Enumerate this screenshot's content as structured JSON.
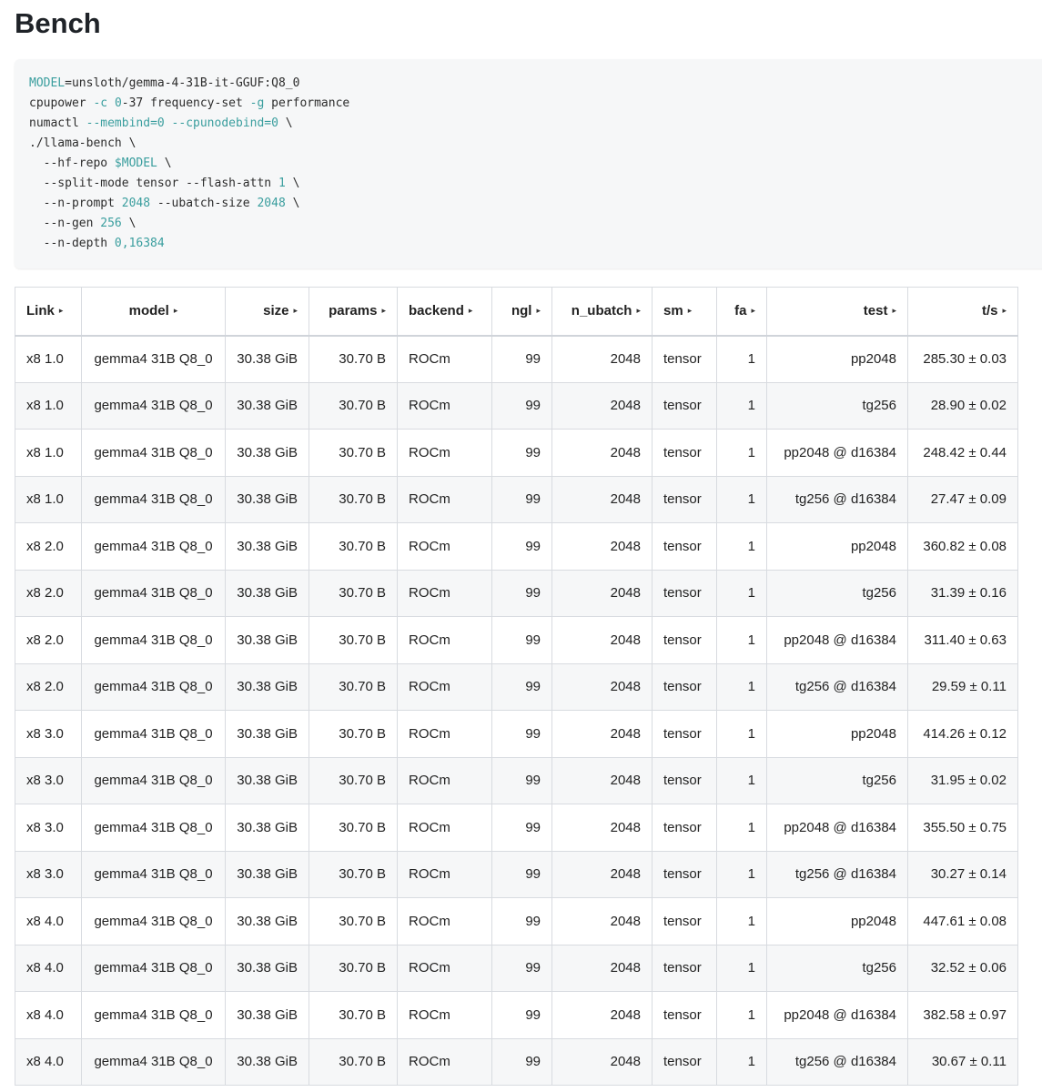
{
  "page": {
    "title": "Bench"
  },
  "code": {
    "lines": [
      [
        {
          "t": "MODEL",
          "hl": true
        },
        {
          "t": "=unsloth/gemma-4-31B-it-GGUF:Q8_0"
        }
      ],
      [
        {
          "t": "cpupower "
        },
        {
          "t": "-c",
          "hl": true
        },
        {
          "t": " "
        },
        {
          "t": "0",
          "hl": true
        },
        {
          "t": "-37 frequency-set "
        },
        {
          "t": "-g",
          "hl": true
        },
        {
          "t": " performance"
        }
      ],
      [
        {
          "t": "numactl "
        },
        {
          "t": "--membind=0",
          "hl": true
        },
        {
          "t": " "
        },
        {
          "t": "--cpunodebind=0",
          "hl": true
        },
        {
          "t": " \\"
        }
      ],
      [
        {
          "t": "./llama-bench \\"
        }
      ],
      [
        {
          "t": "  --hf-repo "
        },
        {
          "t": "$MODEL",
          "hl": true
        },
        {
          "t": " \\"
        }
      ],
      [
        {
          "t": "  --split-mode tensor --flash-attn "
        },
        {
          "t": "1",
          "hl": true
        },
        {
          "t": " \\"
        }
      ],
      [
        {
          "t": "  --n-prompt "
        },
        {
          "t": "2048",
          "hl": true
        },
        {
          "t": " --ubatch-size "
        },
        {
          "t": "2048",
          "hl": true
        },
        {
          "t": " \\"
        }
      ],
      [
        {
          "t": "  --n-gen "
        },
        {
          "t": "256",
          "hl": true
        },
        {
          "t": " \\"
        }
      ],
      [
        {
          "t": "  --n-depth "
        },
        {
          "t": "0,16384",
          "hl": true
        }
      ]
    ]
  },
  "table": {
    "sort_glyph": "▸",
    "columns": [
      {
        "key": "link",
        "label": "Link",
        "align": "l",
        "width": 73
      },
      {
        "key": "model",
        "label": "model",
        "align": "c",
        "width": 158
      },
      {
        "key": "size",
        "label": "size",
        "align": "r",
        "width": 92
      },
      {
        "key": "params",
        "label": "params",
        "align": "r",
        "width": 97
      },
      {
        "key": "backend",
        "label": "backend",
        "align": "l",
        "width": 104
      },
      {
        "key": "ngl",
        "label": "ngl",
        "align": "r",
        "width": 66
      },
      {
        "key": "n_ubatch",
        "label": "n_ubatch",
        "align": "r",
        "width": 110
      },
      {
        "key": "sm",
        "label": "sm",
        "align": "l",
        "width": 71
      },
      {
        "key": "fa",
        "label": "fa",
        "align": "r",
        "width": 55
      },
      {
        "key": "test",
        "label": "test",
        "align": "r",
        "width": 155
      },
      {
        "key": "ts",
        "label": "t/s",
        "align": "r",
        "width": 121
      }
    ],
    "rows": [
      {
        "link": "x8 1.0",
        "model": "gemma4 31B Q8_0",
        "size": "30.38 GiB",
        "params": "30.70 B",
        "backend": "ROCm",
        "ngl": "99",
        "n_ubatch": "2048",
        "sm": "tensor",
        "fa": "1",
        "test": "pp2048",
        "ts": "285.30 ± 0.03"
      },
      {
        "link": "x8 1.0",
        "model": "gemma4 31B Q8_0",
        "size": "30.38 GiB",
        "params": "30.70 B",
        "backend": "ROCm",
        "ngl": "99",
        "n_ubatch": "2048",
        "sm": "tensor",
        "fa": "1",
        "test": "tg256",
        "ts": "28.90 ± 0.02"
      },
      {
        "link": "x8 1.0",
        "model": "gemma4 31B Q8_0",
        "size": "30.38 GiB",
        "params": "30.70 B",
        "backend": "ROCm",
        "ngl": "99",
        "n_ubatch": "2048",
        "sm": "tensor",
        "fa": "1",
        "test": "pp2048 @ d16384",
        "ts": "248.42 ± 0.44"
      },
      {
        "link": "x8 1.0",
        "model": "gemma4 31B Q8_0",
        "size": "30.38 GiB",
        "params": "30.70 B",
        "backend": "ROCm",
        "ngl": "99",
        "n_ubatch": "2048",
        "sm": "tensor",
        "fa": "1",
        "test": "tg256 @ d16384",
        "ts": "27.47 ± 0.09"
      },
      {
        "link": "x8 2.0",
        "model": "gemma4 31B Q8_0",
        "size": "30.38 GiB",
        "params": "30.70 B",
        "backend": "ROCm",
        "ngl": "99",
        "n_ubatch": "2048",
        "sm": "tensor",
        "fa": "1",
        "test": "pp2048",
        "ts": "360.82 ± 0.08"
      },
      {
        "link": "x8 2.0",
        "model": "gemma4 31B Q8_0",
        "size": "30.38 GiB",
        "params": "30.70 B",
        "backend": "ROCm",
        "ngl": "99",
        "n_ubatch": "2048",
        "sm": "tensor",
        "fa": "1",
        "test": "tg256",
        "ts": "31.39 ± 0.16"
      },
      {
        "link": "x8 2.0",
        "model": "gemma4 31B Q8_0",
        "size": "30.38 GiB",
        "params": "30.70 B",
        "backend": "ROCm",
        "ngl": "99",
        "n_ubatch": "2048",
        "sm": "tensor",
        "fa": "1",
        "test": "pp2048 @ d16384",
        "ts": "311.40 ± 0.63"
      },
      {
        "link": "x8 2.0",
        "model": "gemma4 31B Q8_0",
        "size": "30.38 GiB",
        "params": "30.70 B",
        "backend": "ROCm",
        "ngl": "99",
        "n_ubatch": "2048",
        "sm": "tensor",
        "fa": "1",
        "test": "tg256 @ d16384",
        "ts": "29.59 ± 0.11"
      },
      {
        "link": "x8 3.0",
        "model": "gemma4 31B Q8_0",
        "size": "30.38 GiB",
        "params": "30.70 B",
        "backend": "ROCm",
        "ngl": "99",
        "n_ubatch": "2048",
        "sm": "tensor",
        "fa": "1",
        "test": "pp2048",
        "ts": "414.26 ± 0.12"
      },
      {
        "link": "x8 3.0",
        "model": "gemma4 31B Q8_0",
        "size": "30.38 GiB",
        "params": "30.70 B",
        "backend": "ROCm",
        "ngl": "99",
        "n_ubatch": "2048",
        "sm": "tensor",
        "fa": "1",
        "test": "tg256",
        "ts": "31.95 ± 0.02"
      },
      {
        "link": "x8 3.0",
        "model": "gemma4 31B Q8_0",
        "size": "30.38 GiB",
        "params": "30.70 B",
        "backend": "ROCm",
        "ngl": "99",
        "n_ubatch": "2048",
        "sm": "tensor",
        "fa": "1",
        "test": "pp2048 @ d16384",
        "ts": "355.50 ± 0.75"
      },
      {
        "link": "x8 3.0",
        "model": "gemma4 31B Q8_0",
        "size": "30.38 GiB",
        "params": "30.70 B",
        "backend": "ROCm",
        "ngl": "99",
        "n_ubatch": "2048",
        "sm": "tensor",
        "fa": "1",
        "test": "tg256 @ d16384",
        "ts": "30.27 ± 0.14"
      },
      {
        "link": "x8 4.0",
        "model": "gemma4 31B Q8_0",
        "size": "30.38 GiB",
        "params": "30.70 B",
        "backend": "ROCm",
        "ngl": "99",
        "n_ubatch": "2048",
        "sm": "tensor",
        "fa": "1",
        "test": "pp2048",
        "ts": "447.61 ± 0.08"
      },
      {
        "link": "x8 4.0",
        "model": "gemma4 31B Q8_0",
        "size": "30.38 GiB",
        "params": "30.70 B",
        "backend": "ROCm",
        "ngl": "99",
        "n_ubatch": "2048",
        "sm": "tensor",
        "fa": "1",
        "test": "tg256",
        "ts": "32.52 ± 0.06"
      },
      {
        "link": "x8 4.0",
        "model": "gemma4 31B Q8_0",
        "size": "30.38 GiB",
        "params": "30.70 B",
        "backend": "ROCm",
        "ngl": "99",
        "n_ubatch": "2048",
        "sm": "tensor",
        "fa": "1",
        "test": "pp2048 @ d16384",
        "ts": "382.58 ± 0.97"
      },
      {
        "link": "x8 4.0",
        "model": "gemma4 31B Q8_0",
        "size": "30.38 GiB",
        "params": "30.70 B",
        "backend": "ROCm",
        "ngl": "99",
        "n_ubatch": "2048",
        "sm": "tensor",
        "fa": "1",
        "test": "tg256 @ d16384",
        "ts": "30.67 ± 0.11"
      }
    ]
  }
}
